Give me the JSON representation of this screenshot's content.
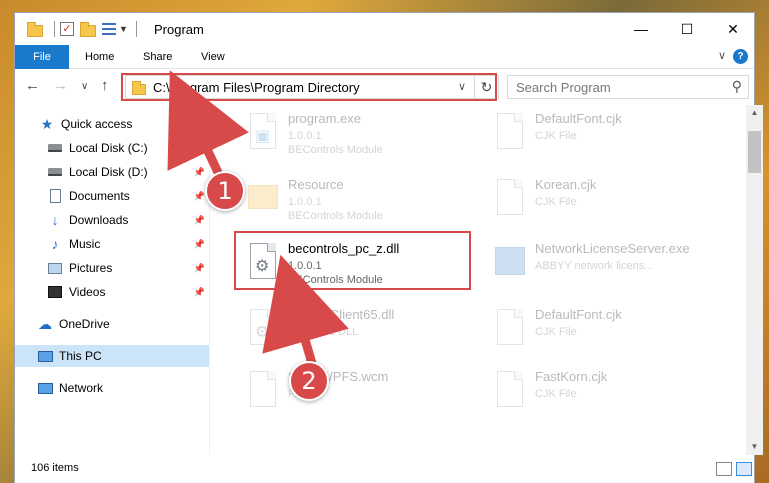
{
  "window": {
    "title": "Program",
    "controls": {
      "minimize": "—",
      "maximize": "☐",
      "close": "✕"
    }
  },
  "ribbon": {
    "tabs": [
      "File",
      "Home",
      "Share",
      "View"
    ],
    "expand": "∨",
    "help": "?"
  },
  "nav": {
    "back": "←",
    "forward": "→",
    "recent": "∨",
    "up": "↑"
  },
  "address": {
    "path": "C:\\Program Files\\Program Directory",
    "dropdown": "∨",
    "refresh": "↻"
  },
  "search": {
    "placeholder": "Search Program",
    "icon": "⚲"
  },
  "sidebar": {
    "items": [
      {
        "label": "Quick access",
        "icon": "star-icon"
      },
      {
        "label": "Local Disk (C:)",
        "icon": "disk-icon",
        "pin": "📌"
      },
      {
        "label": "Local Disk (D:)",
        "icon": "disk-icon",
        "pin": "📌"
      },
      {
        "label": "Documents",
        "icon": "documents-icon",
        "pin": "📌"
      },
      {
        "label": "Downloads",
        "icon": "downloads-icon",
        "pin": "📌"
      },
      {
        "label": "Music",
        "icon": "music-icon",
        "pin": "📌"
      },
      {
        "label": "Pictures",
        "icon": "pictures-icon",
        "pin": "📌"
      },
      {
        "label": "Videos",
        "icon": "videos-icon",
        "pin": "📌"
      },
      {
        "label": "OneDrive",
        "icon": "onedrive-icon"
      },
      {
        "label": "This PC",
        "icon": "this-pc-icon"
      },
      {
        "label": "Network",
        "icon": "network-icon"
      }
    ]
  },
  "files": [
    {
      "name": "program.exe",
      "line2": "1.0.0.1",
      "line3": "BEControls Module",
      "type": "exe"
    },
    {
      "name": "DefaultFont.cjk",
      "line2": "CJK File",
      "line3": "",
      "type": "file"
    },
    {
      "name": "Resource",
      "line2": "1.0.0.1",
      "line3": "BEControls Module",
      "type": "folder"
    },
    {
      "name": "Korean.cjk",
      "line2": "CJK File",
      "line3": "",
      "type": "file"
    },
    {
      "name": "becontrols_pc_z.dll",
      "line2": "1.0.0.1",
      "line3": "BEControls Module",
      "type": "dll"
    },
    {
      "name": "NetworkLicenseServer.exe",
      "line2": "ABBYY network licens...",
      "line3": "",
      "type": "exe"
    },
    {
      "name": "UpdateClient65.dll",
      "line2": "Resource DLL",
      "line3": "",
      "type": "dll"
    },
    {
      "name": "DefaultFont.cjk",
      "line2": "CJK File",
      "line3": "",
      "type": "file"
    },
    {
      "name": "ScrollWPFS.wcm",
      "line2": "File",
      "line3": "",
      "type": "file"
    },
    {
      "name": "FastKorn.cjk",
      "line2": "CJK File",
      "line3": "",
      "type": "file"
    }
  ],
  "status": {
    "count": "106 items"
  },
  "annotations": {
    "badge1": "1",
    "badge2": "2"
  },
  "colors": {
    "accent": "#1979ca",
    "highlight": "#d84a4a",
    "selected": "#cce4f7"
  }
}
